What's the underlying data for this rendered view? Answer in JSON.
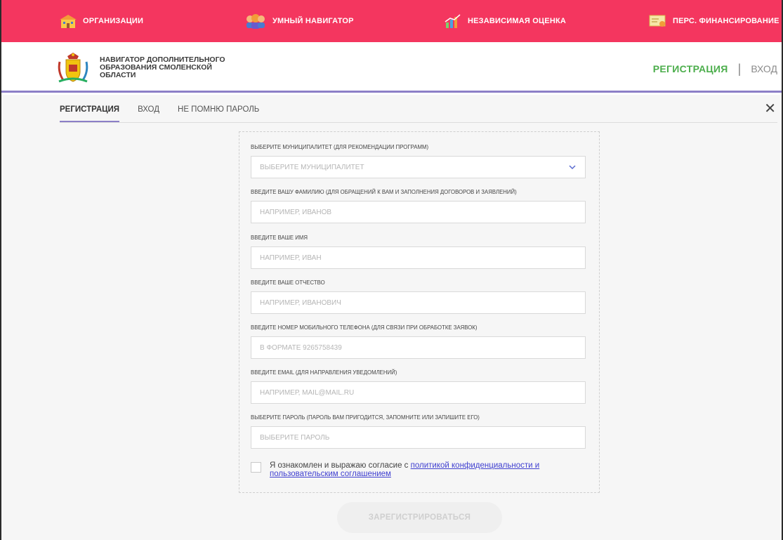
{
  "topnav": {
    "items": [
      {
        "label": "ОРГАНИЗАЦИИ",
        "icon": "school-building-icon"
      },
      {
        "label": "УМНЫЙ НАВИГАТОР",
        "icon": "people-group-icon"
      },
      {
        "label": "НЕЗАВИСИМАЯ ОЦЕНКА",
        "icon": "bar-chart-icon"
      },
      {
        "label": "ПЕРС. ФИНАНСИРОВАНИЕ",
        "icon": "certificate-icon"
      }
    ],
    "color": "#f4365f"
  },
  "header": {
    "logo": "smolensk-coat-of-arms",
    "brand_line1": "НАВИГАТОР ДОПОЛНИТЕЛЬНОГО",
    "brand_line2": "ОБРАЗОВАНИЯ СМОЛЕНСКОЙ",
    "brand_line3": "ОБЛАСТИ",
    "register": "РЕГИСТРАЦИЯ",
    "separator": "|",
    "login": "ВХОД"
  },
  "tabs": {
    "register": "РЕГИСТРАЦИЯ",
    "login": "ВХОД",
    "forgot": "НЕ ПОМНЮ ПАРОЛЬ",
    "close": "✕"
  },
  "form": {
    "municipality_label": "ВЫБЕРИТЕ МУНИЦИПАЛИТЕТ (ДЛЯ РЕКОМЕНДАЦИИ ПРОГРАММ)",
    "municipality_value": "ВЫБЕРИТЕ МУНИЦИПАЛИТЕТ",
    "surname_label": "ВВЕДИТЕ ВАШУ ФАМИЛИЮ (ДЛЯ ОБРАЩЕНИЙ К ВАМ И ЗАПОЛНЕНИЯ ДОГОВОРОВ И ЗАЯВЛЕНИЙ)",
    "surname_placeholder": "НАПРИМЕР, ИВАНОВ",
    "name_label": "ВВЕДИТЕ ВАШЕ ИМЯ",
    "name_placeholder": "НАПРИМЕР, ИВАН",
    "patronymic_label": "ВВЕДИТЕ ВАШЕ ОТЧЕСТВО",
    "patronymic_placeholder": "НАПРИМЕР, ИВАНОВИЧ",
    "phone_label": "ВВЕДИТЕ НОМЕР МОБИЛЬНОГО ТЕЛЕФОНА (ДЛЯ СВЯЗИ ПРИ ОБРАБОТКЕ ЗАЯВОК)",
    "phone_placeholder": "В ФОРМАТЕ 9265758439",
    "email_label": "ВВЕДИТЕ EMAIL (ДЛЯ НАПРАВЛЕНИЯ УВЕДОМЛЕНИЙ)",
    "email_placeholder": "НАПРИМЕР, MAIL@MAIL.RU",
    "password_label": "ВЫБЕРИТЕ ПАРОЛЬ (ПАРОЛЬ ВАМ ПРИГОДИТСЯ, ЗАПОМНИТЕ ИЛИ ЗАПИШИТЕ ЕГО)",
    "password_placeholder": "ВЫБЕРИТЕ ПАРОЛЬ",
    "consent_text": "Я ознакомлен и выражаю согласие с ",
    "consent_link": "политикой конфиденциальности и пользовательским соглашением",
    "consent_checked": false,
    "submit": "ЗАРЕГИСТРИРОВАТЬСЯ"
  },
  "colors": {
    "accent": "#8c7fc7",
    "register_green": "#4cae4c"
  }
}
